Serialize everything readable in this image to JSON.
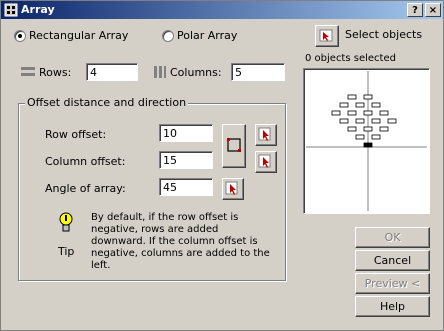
{
  "window": {
    "title": "Array",
    "help_label": "?",
    "close_label": "×"
  },
  "array_type": {
    "rectangular_label": "Rectangular Array",
    "polar_label": "Polar Array",
    "selected": "rectangular"
  },
  "select_objects": {
    "label": "Select objects",
    "status": "0 objects selected"
  },
  "rows": {
    "label": "Rows:",
    "value": "4"
  },
  "columns": {
    "label": "Columns:",
    "value": "5"
  },
  "offset_group": {
    "title": "Offset distance and direction",
    "row_offset_label": "Row offset:",
    "row_offset_value": "10",
    "column_offset_label": "Column offset:",
    "column_offset_value": "15",
    "angle_label": "Angle of array:",
    "angle_value": "45"
  },
  "tip": {
    "label": "Tip",
    "text": "By default, if the row offset is negative, rows are added downward. If the column offset is negative, columns are added to the left."
  },
  "buttons": {
    "ok": "OK",
    "cancel": "Cancel",
    "preview": "Preview <",
    "help": "Help"
  }
}
